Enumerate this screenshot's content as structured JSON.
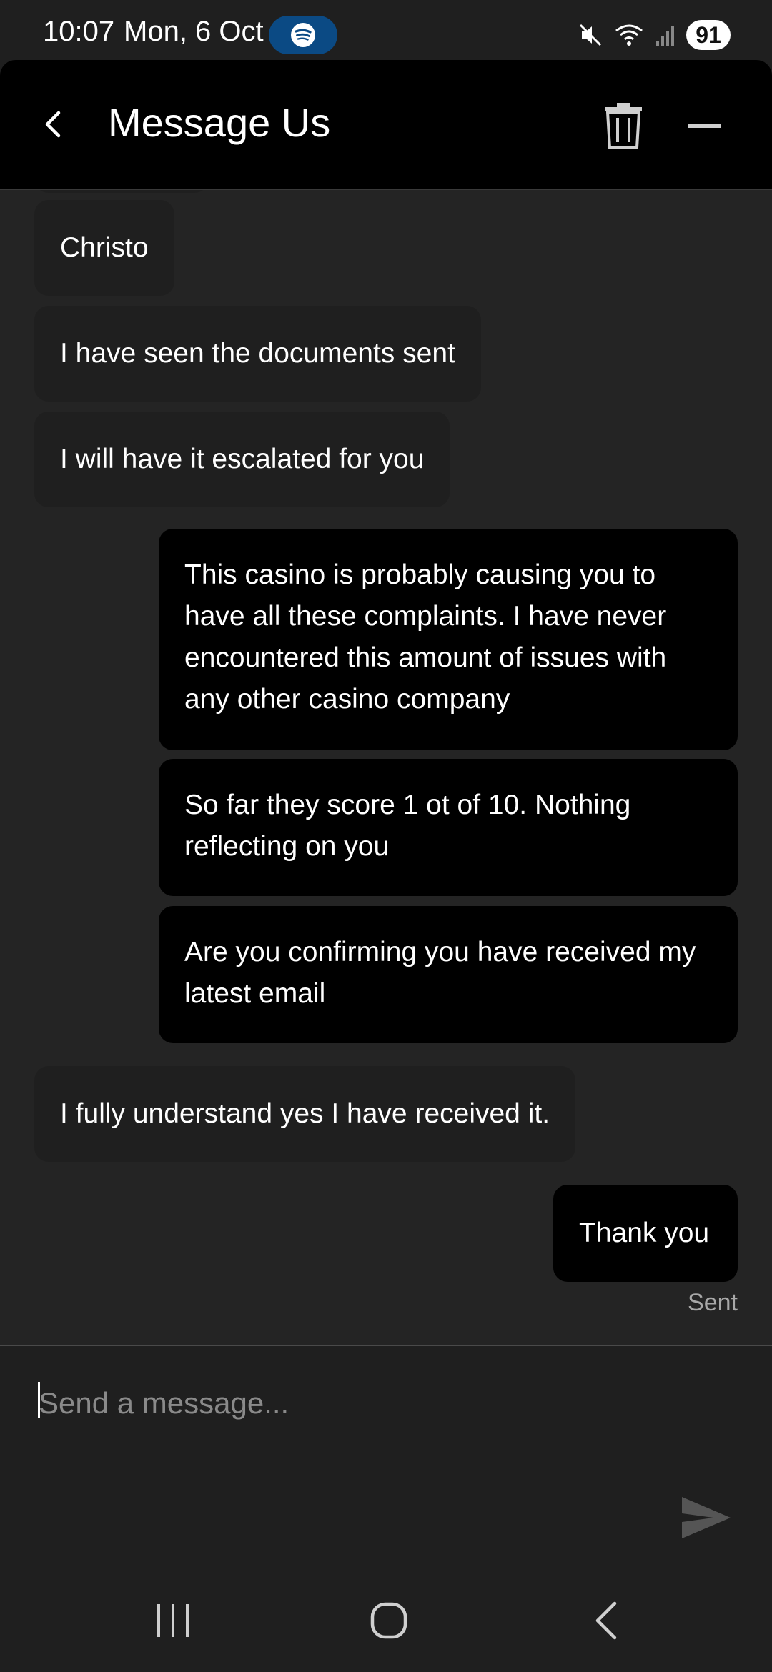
{
  "status_bar": {
    "time": "10:07",
    "date": "Mon, 6 Oct",
    "battery": "91",
    "icons": [
      "spotify-icon",
      "mute-icon",
      "wifi-icon",
      "signal-icon"
    ]
  },
  "header": {
    "title": "Message Us",
    "icons": [
      "back-arrow-icon",
      "trash-icon",
      "minimize-icon"
    ]
  },
  "messages": [
    {
      "direction": "incoming",
      "text": "Christo"
    },
    {
      "direction": "incoming",
      "text": "I have seen the documents sent"
    },
    {
      "direction": "incoming",
      "text": "I will have it escalated for you"
    },
    {
      "direction": "outgoing",
      "text": "This casino is probably causing you to have all these complaints. I have never encountered this amount of issues with any other casino company"
    },
    {
      "direction": "outgoing",
      "text": "So far they score 1 ot of 10. Nothing reflecting on you"
    },
    {
      "direction": "outgoing",
      "text": "Are you confirming you have received my latest email"
    },
    {
      "direction": "incoming",
      "text": "I fully understand yes I have received it."
    },
    {
      "direction": "outgoing",
      "text": "Thank you"
    }
  ],
  "delivery_status": "Sent",
  "composer": {
    "placeholder": "Send a message...",
    "value": ""
  },
  "colors": {
    "background": "#242424",
    "header": "#000000",
    "incoming_bubble": "#1f1f1f",
    "outgoing_bubble": "#000000",
    "spotify_pill": "#0b4a84",
    "muted_text": "#a8a8a8"
  },
  "nav_bar": {
    "icons": [
      "recents-icon",
      "home-icon",
      "back-icon"
    ]
  }
}
